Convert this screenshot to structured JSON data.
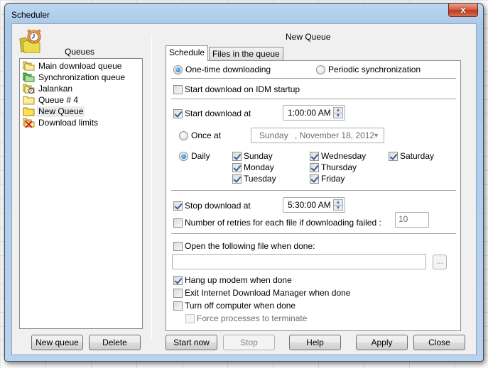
{
  "window": {
    "title": "Scheduler",
    "close_label": "x"
  },
  "left": {
    "header": "Queues",
    "queues": [
      {
        "label": "Main download queue",
        "icon": "queue-folder-icon",
        "selected": false
      },
      {
        "label": "Synchronization queue",
        "icon": "sync-queue-folder-icon",
        "selected": false
      },
      {
        "label": "Jalankan",
        "icon": "scheduled-queue-folder-icon",
        "selected": false
      },
      {
        "label": "Queue # 4",
        "icon": "queue-folder-icon",
        "selected": false
      },
      {
        "label": "New Queue",
        "icon": "queue-folder-icon",
        "selected": true
      },
      {
        "label": "Download limits",
        "icon": "download-limits-icon",
        "selected": false
      }
    ],
    "new_queue_label": "New queue",
    "delete_label": "Delete"
  },
  "right": {
    "title": "New Queue",
    "tabs": [
      {
        "label": "Schedule",
        "active": true
      },
      {
        "label": "Files in the queue",
        "active": false
      }
    ],
    "mode": {
      "one_time_label": "One-time downloading",
      "periodic_label": "Periodic synchronization",
      "selected": "one_time"
    },
    "start_on_idm_startup": {
      "label": "Start download on IDM startup",
      "checked": false
    },
    "start_download_at": {
      "label": "Start download at",
      "checked": true,
      "time": "1:00:00 AM"
    },
    "once_at": {
      "label": "Once at",
      "selected": false,
      "date_day": "Sunday",
      "date_rest": ", November 18, 2012"
    },
    "daily": {
      "label": "Daily",
      "selected": true
    },
    "days": [
      {
        "label": "Sunday",
        "checked": true
      },
      {
        "label": "Monday",
        "checked": true
      },
      {
        "label": "Tuesday",
        "checked": true
      },
      {
        "label": "Wednesday",
        "checked": true
      },
      {
        "label": "Thursday",
        "checked": true
      },
      {
        "label": "Friday",
        "checked": true
      },
      {
        "label": "Saturday",
        "checked": true
      }
    ],
    "stop_download_at": {
      "label": "Stop download at",
      "checked": true,
      "time": "5:30:00 AM"
    },
    "retries": {
      "label": "Number of retries for each file if downloading failed :",
      "checked": false,
      "value": "10"
    },
    "open_file": {
      "label": "Open the following file when done:",
      "checked": false,
      "path": "",
      "browse_label": "..."
    },
    "hang_up": {
      "label": "Hang up modem when done",
      "checked": true
    },
    "exit_idm": {
      "label": "Exit Internet Download Manager when done",
      "checked": false
    },
    "turn_off": {
      "label": "Turn off computer when done",
      "checked": false
    },
    "force_terminate": {
      "label": "Force processes to terminate",
      "checked": false,
      "disabled": true
    }
  },
  "footer": {
    "start_now_label": "Start now",
    "stop_label": "Stop",
    "help_label": "Help",
    "apply_label": "Apply",
    "close_label": "Close"
  }
}
